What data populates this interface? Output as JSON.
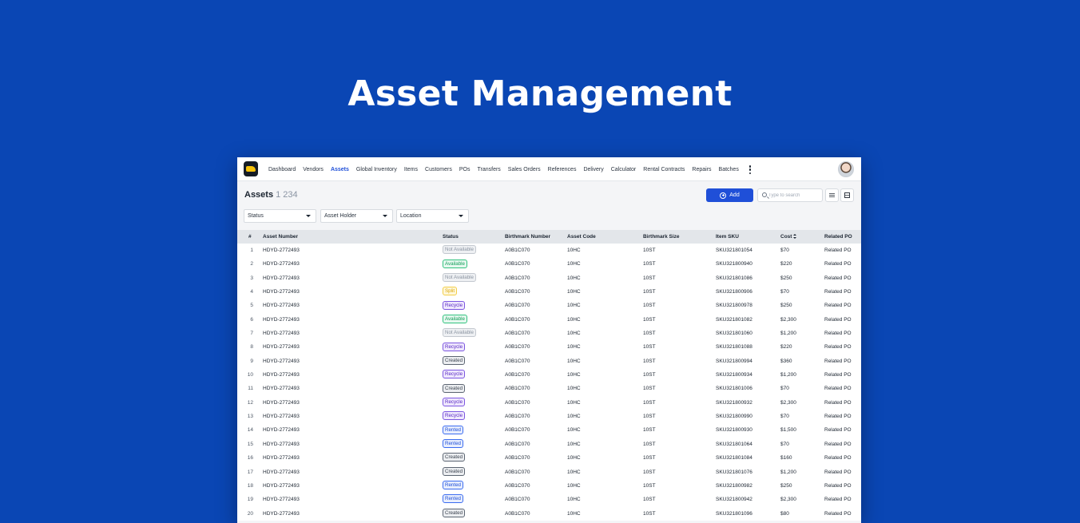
{
  "hero": {
    "title": "Asset Management"
  },
  "nav": {
    "items": [
      {
        "label": "Dashboard",
        "active": false
      },
      {
        "label": "Vendors",
        "active": false
      },
      {
        "label": "Assets",
        "active": true
      },
      {
        "label": "Global Inventory",
        "active": false
      },
      {
        "label": "Items",
        "active": false
      },
      {
        "label": "Customers",
        "active": false
      },
      {
        "label": "POs",
        "active": false
      },
      {
        "label": "Transfers",
        "active": false
      },
      {
        "label": "Sales Orders",
        "active": false
      },
      {
        "label": "References",
        "active": false
      },
      {
        "label": "Delivery",
        "active": false
      },
      {
        "label": "Calculator",
        "active": false
      },
      {
        "label": "Rental Contracts",
        "active": false
      },
      {
        "label": "Repairs",
        "active": false
      },
      {
        "label": "Batches",
        "active": false
      }
    ]
  },
  "header": {
    "title": "Assets",
    "count": "1 234",
    "add_label": "Add",
    "search_placeholder": "Type to search"
  },
  "filters": {
    "status": "Status",
    "asset_holder": "Asset Holder",
    "location": "Location"
  },
  "table": {
    "columns": {
      "index": "#",
      "asset_number": "Asset Number",
      "status": "Status",
      "birthmark_number": "Birthmark Number",
      "asset_code": "Asset Code",
      "birthmark_size": "Birthmark Size",
      "item_sku": "Item SKU",
      "cost": "Cost",
      "related_po": "Related PO"
    },
    "rows": [
      {
        "index": "1",
        "asset_number": "HDYD-2772493",
        "status": "Not Available",
        "birthmark_number": "A0B1C070",
        "asset_code": "10HC",
        "birthmark_size": "10ST",
        "item_sku": "SKU321801054",
        "cost": "$70",
        "related_po": "Related PO"
      },
      {
        "index": "2",
        "asset_number": "HDYD-2772493",
        "status": "Available",
        "birthmark_number": "A0B1C070",
        "asset_code": "10HC",
        "birthmark_size": "10ST",
        "item_sku": "SKU321800940",
        "cost": "$220",
        "related_po": "Related PO"
      },
      {
        "index": "3",
        "asset_number": "HDYD-2772493",
        "status": "Not Available",
        "birthmark_number": "A0B1C070",
        "asset_code": "10HC",
        "birthmark_size": "10ST",
        "item_sku": "SKU321801086",
        "cost": "$250",
        "related_po": "Related PO"
      },
      {
        "index": "4",
        "asset_number": "HDYD-2772493",
        "status": "Split",
        "birthmark_number": "A0B1C070",
        "asset_code": "10HC",
        "birthmark_size": "10ST",
        "item_sku": "SKU321800906",
        "cost": "$70",
        "related_po": "Related PO"
      },
      {
        "index": "5",
        "asset_number": "HDYD-2772493",
        "status": "Recycle",
        "birthmark_number": "A0B1C070",
        "asset_code": "10HC",
        "birthmark_size": "10ST",
        "item_sku": "SKU321800978",
        "cost": "$250",
        "related_po": "Related PO"
      },
      {
        "index": "6",
        "asset_number": "HDYD-2772493",
        "status": "Available",
        "birthmark_number": "A0B1C070",
        "asset_code": "10HC",
        "birthmark_size": "10ST",
        "item_sku": "SKU321801082",
        "cost": "$2,300",
        "related_po": "Related PO"
      },
      {
        "index": "7",
        "asset_number": "HDYD-2772493",
        "status": "Not Available",
        "birthmark_number": "A0B1C070",
        "asset_code": "10HC",
        "birthmark_size": "10ST",
        "item_sku": "SKU321801060",
        "cost": "$1,200",
        "related_po": "Related PO"
      },
      {
        "index": "8",
        "asset_number": "HDYD-2772493",
        "status": "Recycle",
        "birthmark_number": "A0B1C070",
        "asset_code": "10HC",
        "birthmark_size": "10ST",
        "item_sku": "SKU321801088",
        "cost": "$220",
        "related_po": "Related PO"
      },
      {
        "index": "9",
        "asset_number": "HDYD-2772493",
        "status": "Created",
        "birthmark_number": "A0B1C070",
        "asset_code": "10HC",
        "birthmark_size": "10ST",
        "item_sku": "SKU321800994",
        "cost": "$360",
        "related_po": "Related PO"
      },
      {
        "index": "10",
        "asset_number": "HDYD-2772493",
        "status": "Recycle",
        "birthmark_number": "A0B1C070",
        "asset_code": "10HC",
        "birthmark_size": "10ST",
        "item_sku": "SKU321800934",
        "cost": "$1,200",
        "related_po": "Related PO"
      },
      {
        "index": "11",
        "asset_number": "HDYD-2772493",
        "status": "Created",
        "birthmark_number": "A0B1C070",
        "asset_code": "10HC",
        "birthmark_size": "10ST",
        "item_sku": "SKU321801006",
        "cost": "$70",
        "related_po": "Related PO"
      },
      {
        "index": "12",
        "asset_number": "HDYD-2772493",
        "status": "Recycle",
        "birthmark_number": "A0B1C070",
        "asset_code": "10HC",
        "birthmark_size": "10ST",
        "item_sku": "SKU321800932",
        "cost": "$2,300",
        "related_po": "Related PO"
      },
      {
        "index": "13",
        "asset_number": "HDYD-2772493",
        "status": "Recycle",
        "birthmark_number": "A0B1C070",
        "asset_code": "10HC",
        "birthmark_size": "10ST",
        "item_sku": "SKU321800990",
        "cost": "$70",
        "related_po": "Related PO"
      },
      {
        "index": "14",
        "asset_number": "HDYD-2772493",
        "status": "Rented",
        "birthmark_number": "A0B1C070",
        "asset_code": "10HC",
        "birthmark_size": "10ST",
        "item_sku": "SKU321800930",
        "cost": "$1,500",
        "related_po": "Related PO"
      },
      {
        "index": "15",
        "asset_number": "HDYD-2772493",
        "status": "Rented",
        "birthmark_number": "A0B1C070",
        "asset_code": "10HC",
        "birthmark_size": "10ST",
        "item_sku": "SKU321801064",
        "cost": "$70",
        "related_po": "Related PO"
      },
      {
        "index": "16",
        "asset_number": "HDYD-2772493",
        "status": "Created",
        "birthmark_number": "A0B1C070",
        "asset_code": "10HC",
        "birthmark_size": "10ST",
        "item_sku": "SKU321801084",
        "cost": "$160",
        "related_po": "Related PO"
      },
      {
        "index": "17",
        "asset_number": "HDYD-2772493",
        "status": "Created",
        "birthmark_number": "A0B1C070",
        "asset_code": "10HC",
        "birthmark_size": "10ST",
        "item_sku": "SKU321801076",
        "cost": "$1,200",
        "related_po": "Related PO"
      },
      {
        "index": "18",
        "asset_number": "HDYD-2772493",
        "status": "Rented",
        "birthmark_number": "A0B1C070",
        "asset_code": "10HC",
        "birthmark_size": "10ST",
        "item_sku": "SKU321800982",
        "cost": "$250",
        "related_po": "Related PO"
      },
      {
        "index": "19",
        "asset_number": "HDYD-2772493",
        "status": "Rented",
        "birthmark_number": "A0B1C070",
        "asset_code": "10HC",
        "birthmark_size": "10ST",
        "item_sku": "SKU321800942",
        "cost": "$2,300",
        "related_po": "Related PO"
      },
      {
        "index": "20",
        "asset_number": "HDYD-2772493",
        "status": "Created",
        "birthmark_number": "A0B1C070",
        "asset_code": "10HC",
        "birthmark_size": "10ST",
        "item_sku": "SKU321801096",
        "cost": "$80",
        "related_po": "Related PO"
      }
    ]
  },
  "colors": {
    "background": "#0a46b4",
    "accent": "#1f4fd8",
    "available": "#17a05d",
    "split": "#d9a50b",
    "recycle": "#5a2bc4",
    "rented": "#1f4fd8",
    "not_available": "#8b94a1"
  },
  "icons": {
    "logo": "truck-logo-icon",
    "more": "kebab-menu-icon",
    "add": "plus-circle-icon",
    "search": "search-icon",
    "filter": "sliders-icon",
    "columns": "table-columns-icon",
    "sort": "sort-icon",
    "dropdown": "caret-down-icon"
  }
}
